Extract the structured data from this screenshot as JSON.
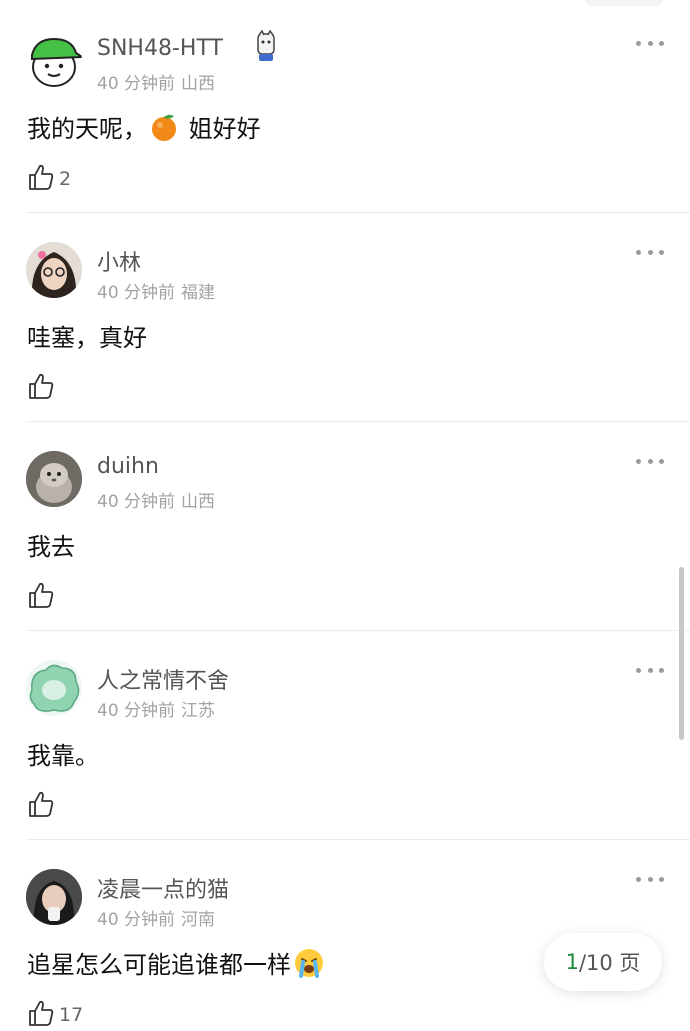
{
  "comments": [
    {
      "user": "SNH48-HTT",
      "time": "40 分钟前",
      "location": "山西",
      "text_before": "我的天呢，",
      "text_after": " 姐好好",
      "likes": "2"
    },
    {
      "user": "小林",
      "time": "40 分钟前",
      "location": "福建",
      "text": "哇塞，真好",
      "likes": ""
    },
    {
      "user": "duihn",
      "time": "40 分钟前",
      "location": "山西",
      "text": "我去",
      "likes": ""
    },
    {
      "user": "人之常情不舍",
      "time": "40 分钟前",
      "location": "江苏",
      "text": "我靠。",
      "likes": ""
    },
    {
      "user": "凌晨一点的猫",
      "time": "40 分钟前",
      "location": "河南",
      "text": "追星怎么可能追谁都一样",
      "likes": "17"
    }
  ],
  "pager": {
    "current": "1",
    "total": "/10 页"
  },
  "icons": {
    "like": "thumb-up-icon",
    "more": "more-dots-icon",
    "orange": "orange-emoji-icon",
    "crying": "crying-emoji-icon"
  },
  "colors": {
    "accent": "#1e8a3c",
    "username": "#555555",
    "meta": "#a3a3a3"
  }
}
